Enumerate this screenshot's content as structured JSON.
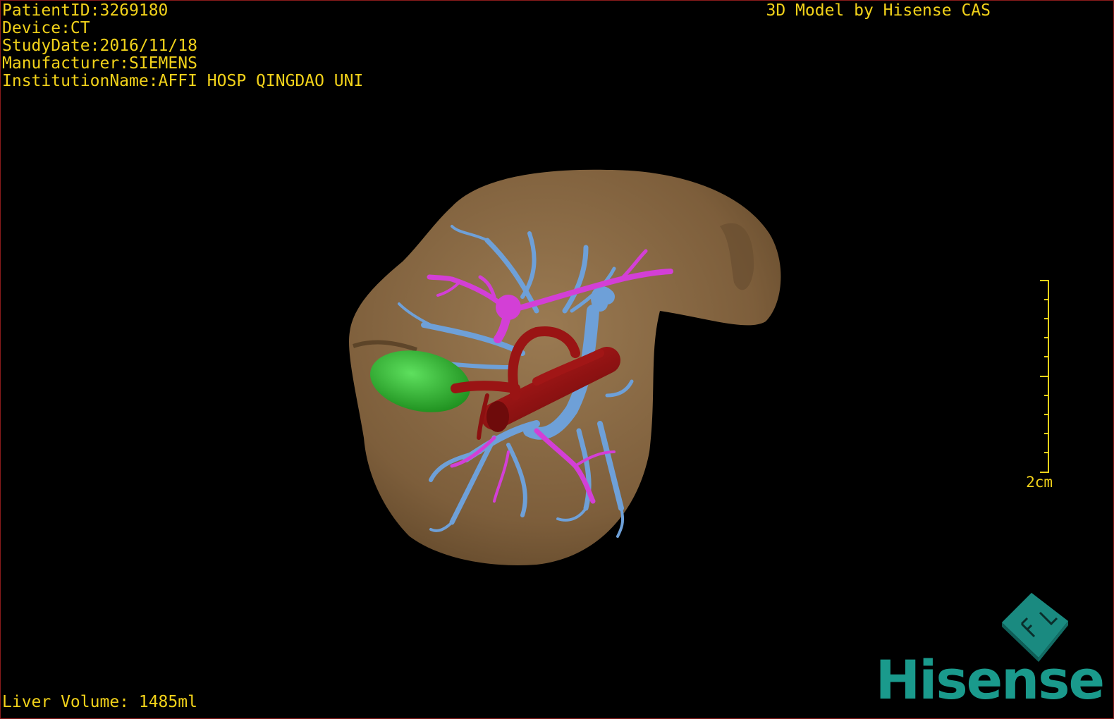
{
  "header": {
    "patient_id": "PatientID:3269180",
    "device": "Device:CT",
    "study_date": "StudyDate:2016/11/18",
    "manufacturer": "Manufacturer:SIEMENS",
    "institution": "InstitutionName:AFFI HOSP QINGDAO UNI",
    "credit": "3D Model by Hisense CAS"
  },
  "footer": {
    "liver_volume": "Liver Volume: 1485ml"
  },
  "scale": {
    "label": "2cm"
  },
  "orientation": {
    "label": "FL"
  },
  "brand": {
    "logo_text": "Hisense"
  },
  "model": {
    "structures": [
      "liver",
      "portal-vein",
      "hepatic-vein",
      "hepatic-artery",
      "gallbladder"
    ],
    "colors": {
      "liver": "#8b6a44",
      "hepatic_vein": "#6ea0d8",
      "portal_vein": "#d33fd6",
      "artery": "#8c1010",
      "gallbladder": "#2bbf2b",
      "overlay_text": "#f2d21a",
      "logo": "#1a9a8c"
    }
  }
}
